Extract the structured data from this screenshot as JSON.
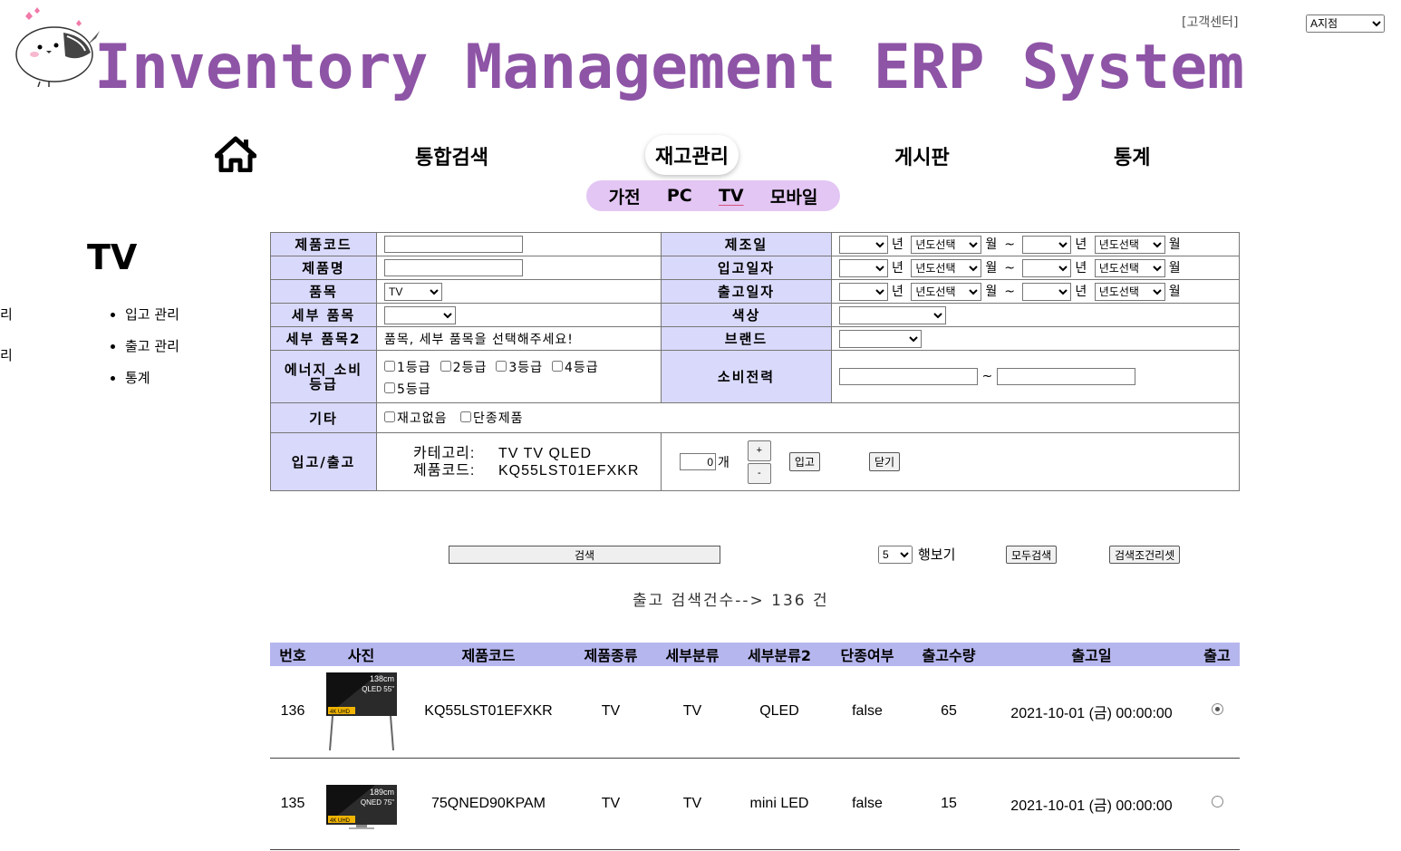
{
  "header": {
    "title": "Inventory Management ERP System",
    "support_link": "[고객센터]",
    "branch_selected": "A지점"
  },
  "nav": {
    "items": [
      "통합검색",
      "재고관리",
      "게시판",
      "통계"
    ],
    "active": "재고관리",
    "sub_items": [
      "가전",
      "PC",
      "TV",
      "모바일"
    ],
    "sub_active": "TV"
  },
  "sidebar": {
    "title": "TV",
    "cut_items": [
      "리",
      "리"
    ],
    "items": [
      "입고 관리",
      "출고 관리",
      "통계"
    ]
  },
  "form": {
    "labels": {
      "product_code": "제품코드",
      "product_name": "제품명",
      "category": "품목",
      "sub_category": "세부 품목",
      "sub_category2": "세부 품목2",
      "energy": "에너지 소비 등급",
      "etc": "기타",
      "in_out": "입고/출고",
      "mfg_date": "제조일",
      "in_date": "입고일자",
      "out_date": "출고일자",
      "color": "색상",
      "brand": "브랜드",
      "power": "소비전력"
    },
    "category_value": "TV",
    "sub_category2_hint": "품목, 세부 품목을 선택해주세요!",
    "year_unit": "년",
    "month_unit": "월",
    "tilde": "~",
    "year_placeholder": "년도선택",
    "energy_grades": [
      "1등급",
      "2등급",
      "3등급",
      "4등급",
      "5등급"
    ],
    "etc_options": [
      "재고없음",
      "단종제품"
    ],
    "in_out": {
      "category_label": "카테고리:",
      "category_value": "TV TV QLED",
      "code_label": "제품코드:",
      "code_value": "KQ55LST01EFXKR",
      "qty_value": "0",
      "qty_unit": "개",
      "plus": "+",
      "minus": "-",
      "in_button": "입고",
      "close_button": "닫기"
    }
  },
  "controls": {
    "search_button": "검색",
    "rows_value": "5",
    "rows_label": "행보기",
    "all_search_button": "모두검색",
    "reset_button": "검색조건리셋",
    "result_count": "출고 검색건수--> 136 건"
  },
  "table": {
    "headers": [
      "번호",
      "사진",
      "제품코드",
      "제품종류",
      "세부분류",
      "세부분류2",
      "단종여부",
      "출고수량",
      "출고일",
      "출고"
    ],
    "rows": [
      {
        "no": "136",
        "photo_size": "138cm",
        "photo_model": "QLED 55\"",
        "photo_badge": "4K UHD",
        "code": "KQ55LST01EFXKR",
        "type": "TV",
        "sub": "TV",
        "sub2": "QLED",
        "discontinued": "false",
        "qty": "65",
        "date": "2021-10-01 (금) 00:00:00",
        "selected": true
      },
      {
        "no": "135",
        "photo_size": "189cm",
        "photo_model": "QNED 75\"",
        "photo_badge": "4K UHD",
        "code": "75QNED90KPAM",
        "type": "TV",
        "sub": "TV",
        "sub2": "mini LED",
        "discontinued": "false",
        "qty": "15",
        "date": "2021-10-01 (금) 00:00:00",
        "selected": false
      }
    ]
  },
  "colors": {
    "title": "#8e54a6",
    "label_bg": "#d9d9fb",
    "header_bg": "#b6b6ef",
    "subnav_bg": "#e3c6f3"
  }
}
